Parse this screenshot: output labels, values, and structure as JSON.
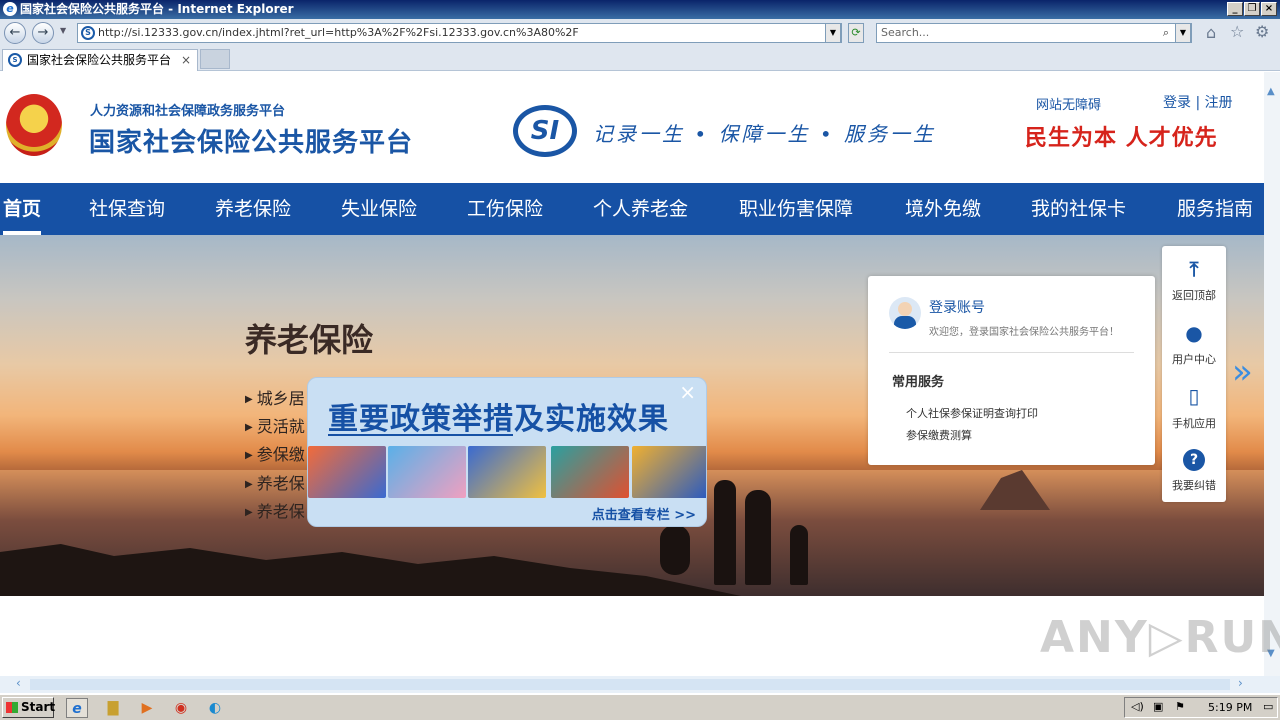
{
  "window": {
    "title": "国家社会保险公共服务平台 - Internet Explorer"
  },
  "browser": {
    "address": "http://si.12333.gov.cn/index.jhtml?ret_url=http%3A%2F%2Fsi.12333.gov.cn%3A80%2F",
    "search_placeholder": "Search...",
    "tab_title": "国家社会保险公共服务平台"
  },
  "header": {
    "subtitle": "人力资源和社会保障政务服务平台",
    "title": "国家社会保险公共服务平台",
    "logo_text": "SI",
    "slogan": "记录一生 • 保障一生 • 服务一生",
    "accessibility": "网站无障碍",
    "login": "登录 | 注册",
    "motto": "民生为本  人才优先"
  },
  "menu": [
    {
      "label": "首页"
    },
    {
      "label": "社保查询"
    },
    {
      "label": "养老保险"
    },
    {
      "label": "失业保险"
    },
    {
      "label": "工伤保险"
    },
    {
      "label": "个人养老金"
    },
    {
      "label": "职业伤害保障"
    },
    {
      "label": "境外免缴"
    },
    {
      "label": "我的社保卡"
    },
    {
      "label": "服务指南"
    }
  ],
  "banner": {
    "title": "养老保险",
    "items": [
      "城乡居",
      "灵活就",
      "参保缴",
      "养老保",
      "养老保"
    ]
  },
  "popup": {
    "title": "重要政策举措及实施效果",
    "close": "×",
    "link": "点击查看专栏 >>"
  },
  "login_card": {
    "login_label": "登录账号",
    "welcome": "欢迎您，登录国家社会保险公共服务平台！",
    "section_title": "常用服务",
    "services": [
      "个人社保参保证明查询打印",
      "参保缴费测算"
    ]
  },
  "sidebar": [
    {
      "label": "返回顶部",
      "icon": "arrow-up-icon"
    },
    {
      "label": "用户中心",
      "icon": "user-icon"
    },
    {
      "label": "手机应用",
      "icon": "phone-icon"
    },
    {
      "label": "我要纠错",
      "icon": "help-icon"
    }
  ],
  "watermark": "ANY▷RUN",
  "taskbar": {
    "start": "Start",
    "clock": "5:19 PM"
  },
  "colors": {
    "brand_blue": "#1651a5",
    "motto_red": "#d6231b"
  }
}
